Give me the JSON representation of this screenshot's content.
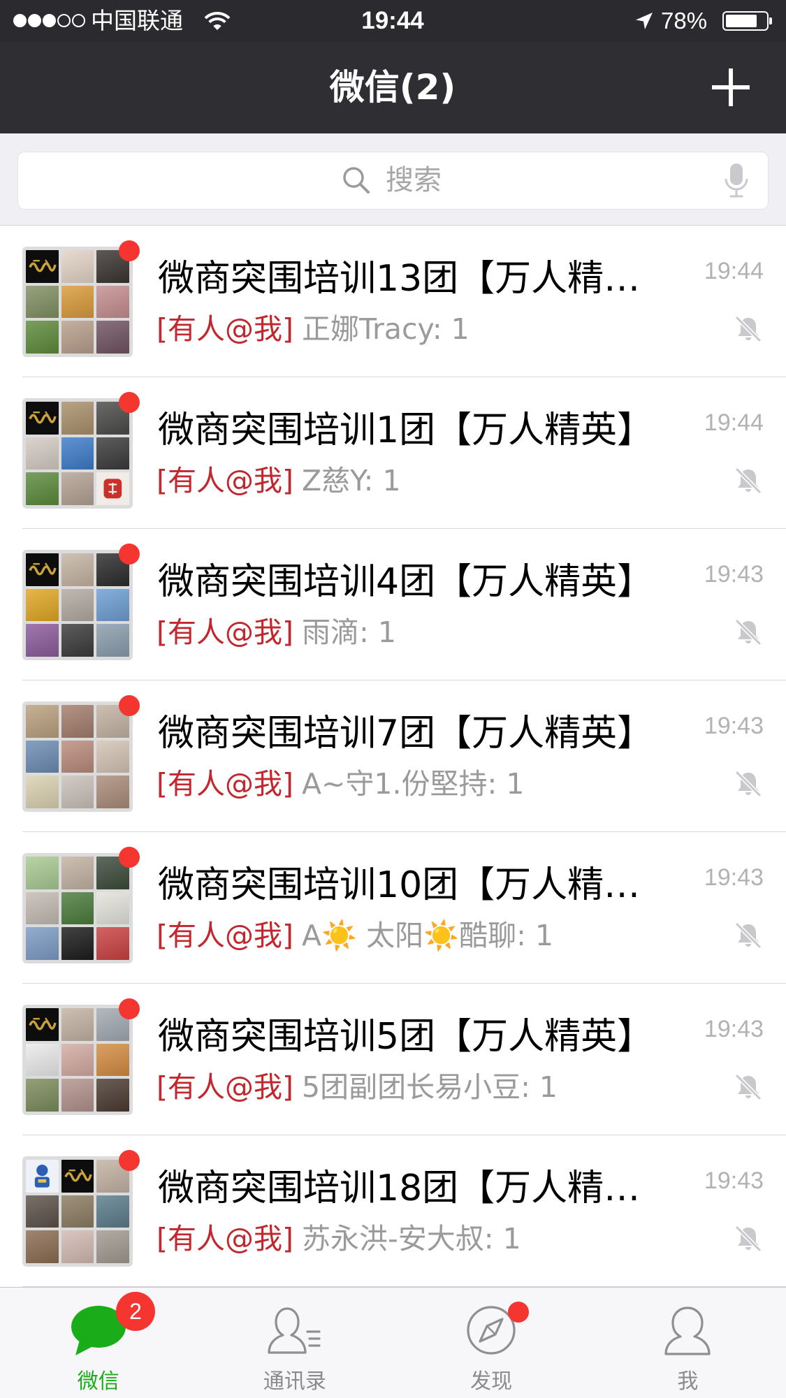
{
  "status_bar": {
    "signal_strength": 3,
    "signal_max": 5,
    "carrier": "中国联通",
    "wifi_icon": "wifi-icon",
    "time": "19:44",
    "location_icon": "location-arrow-icon",
    "battery_text": "78%",
    "battery_level": 0.78
  },
  "nav": {
    "title": "微信(2)",
    "add_icon": "plus-icon"
  },
  "search": {
    "placeholder": "搜索",
    "icon": "search-icon",
    "voice_icon": "microphone-icon"
  },
  "chats": [
    {
      "title": "微商突围培训13团【万人精…",
      "mention": "[有人@我]",
      "preview": "正娜Tracy: 1",
      "time": "19:44",
      "unread_dot": true,
      "muted": true
    },
    {
      "title": "微商突围培训1团【万人精英】",
      "mention": "[有人@我]",
      "preview": "Z慈Y: 1",
      "time": "19:44",
      "unread_dot": true,
      "muted": true
    },
    {
      "title": "微商突围培训4团【万人精英】",
      "mention": "[有人@我]",
      "preview": "雨滴: 1",
      "time": "19:43",
      "unread_dot": true,
      "muted": true
    },
    {
      "title": "微商突围培训7团【万人精英】",
      "mention": "[有人@我]",
      "preview": "A~守1.份堅持: 1",
      "time": "19:43",
      "unread_dot": true,
      "muted": true
    },
    {
      "title": "微商突围培训10团【万人精…",
      "mention": "[有人@我]",
      "preview": "A☀️ 太阳☀️酷聊: 1",
      "time": "19:43",
      "unread_dot": true,
      "muted": true
    },
    {
      "title": "微商突围培训5团【万人精英】",
      "mention": "[有人@我]",
      "preview": "5团副团长易小豆: 1",
      "time": "19:43",
      "unread_dot": true,
      "muted": true
    },
    {
      "title": "微商突围培训18团【万人精…",
      "mention": "[有人@我]",
      "preview": "苏永洪-安大叔: 1",
      "time": "19:43",
      "unread_dot": true,
      "muted": true
    }
  ],
  "tab_bar": {
    "tabs": [
      {
        "label": "微信",
        "icon": "chat-bubble-icon",
        "active": true,
        "badge": "2"
      },
      {
        "label": "通讯录",
        "icon": "contacts-icon",
        "active": false
      },
      {
        "label": "发现",
        "icon": "compass-icon",
        "active": false,
        "red_dot": true
      },
      {
        "label": "我",
        "icon": "person-icon",
        "active": false
      }
    ]
  },
  "colors": {
    "status_bg": "#2a2a2f",
    "nav_bg": "#2e2e33",
    "accent_green": "#1aad19",
    "mention_red": "#c1272d",
    "badge_red": "#f43530",
    "time_gray": "#b2b2b2",
    "preview_gray": "#9a9a9a"
  }
}
